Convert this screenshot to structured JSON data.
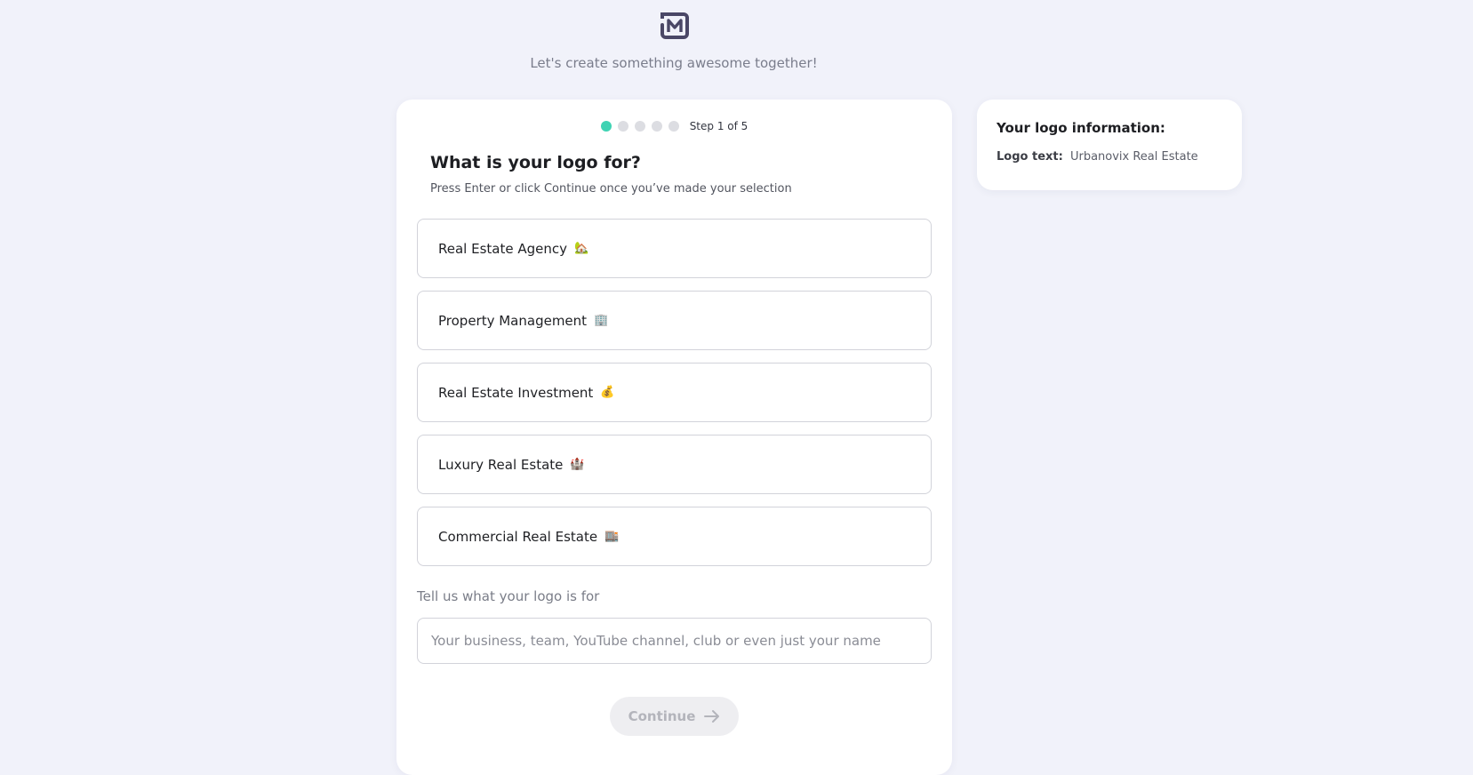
{
  "header": {
    "logo_icon": "m-brand-logo-icon",
    "tagline": "Let's create something awesome together!"
  },
  "colors": {
    "accent": "#3fd3b3",
    "logo": "#4a4766",
    "background": "#f1f2fa"
  },
  "wizard": {
    "steps_total": 5,
    "current_step": 1,
    "step_text": "Step 1 of 5",
    "title": "What is your logo for?",
    "subtitle": "Press Enter or click Continue once you’ve made your selection",
    "options": [
      {
        "label": "Real Estate Agency",
        "emoji": "🏡"
      },
      {
        "label": "Property Management",
        "emoji": "🏢"
      },
      {
        "label": "Real Estate Investment",
        "emoji": "💰"
      },
      {
        "label": "Luxury Real Estate",
        "emoji": "🏰"
      },
      {
        "label": "Commercial Real Estate",
        "emoji": "🏬"
      }
    ],
    "custom_field": {
      "label": "Tell us what your logo is for",
      "placeholder": "Your business, team, YouTube channel, club or even just your name",
      "value": ""
    },
    "continue_label": "Continue",
    "continue_icon": "arrow-right-icon"
  },
  "info_panel": {
    "title": "Your logo information:",
    "logo_text_key": "Logo text:",
    "logo_text_value": "Urbanovix Real Estate"
  }
}
